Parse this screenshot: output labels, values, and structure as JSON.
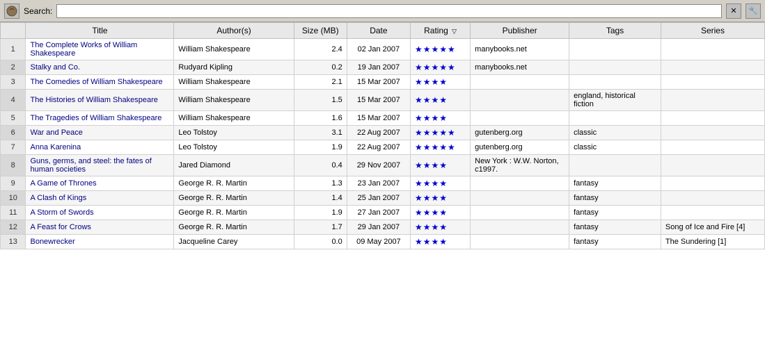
{
  "toolbar": {
    "search_label": "Search:",
    "search_value": "",
    "search_placeholder": ""
  },
  "table": {
    "columns": [
      "Title",
      "Author(s)",
      "Size (MB)",
      "Date",
      "Rating",
      "Publisher",
      "Tags",
      "Series"
    ],
    "rows": [
      {
        "num": 1,
        "title": "The Complete Works of William Shakespeare",
        "authors": "William Shakespeare",
        "size": "2.4",
        "date": "02 Jan 2007",
        "rating": 5,
        "publisher": "manybooks.net",
        "tags": "",
        "series": ""
      },
      {
        "num": 2,
        "title": "Stalky and Co.",
        "authors": "Rudyard Kipling",
        "size": "0.2",
        "date": "19 Jan 2007",
        "rating": 5,
        "publisher": "manybooks.net",
        "tags": "",
        "series": ""
      },
      {
        "num": 3,
        "title": "The Comedies of William Shakespeare",
        "authors": "William Shakespeare",
        "size": "2.1",
        "date": "15 Mar 2007",
        "rating": 4,
        "publisher": "",
        "tags": "",
        "series": ""
      },
      {
        "num": 4,
        "title": "The Histories of William Shakespeare",
        "authors": "William Shakespeare",
        "size": "1.5",
        "date": "15 Mar 2007",
        "rating": 4,
        "publisher": "",
        "tags": "england, historical fiction",
        "series": ""
      },
      {
        "num": 5,
        "title": "The Tragedies of William Shakespeare",
        "authors": "William Shakespeare",
        "size": "1.6",
        "date": "15 Mar 2007",
        "rating": 4,
        "publisher": "",
        "tags": "",
        "series": ""
      },
      {
        "num": 6,
        "title": "War and Peace",
        "authors": "Leo Tolstoy",
        "size": "3.1",
        "date": "22 Aug 2007",
        "rating": 5,
        "publisher": "gutenberg.org",
        "tags": "classic",
        "series": ""
      },
      {
        "num": 7,
        "title": "Anna Karenina",
        "authors": "Leo Tolstoy",
        "size": "1.9",
        "date": "22 Aug 2007",
        "rating": 5,
        "publisher": "gutenberg.org",
        "tags": "classic",
        "series": ""
      },
      {
        "num": 8,
        "title": "Guns, germs, and steel: the fates of human societies",
        "authors": "Jared Diamond",
        "size": "0.4",
        "date": "29 Nov 2007",
        "rating": 4,
        "publisher": "New York : W.W. Norton, c1997.",
        "tags": "",
        "series": ""
      },
      {
        "num": 9,
        "title": "A Game of Thrones",
        "authors": "George R. R. Martin",
        "size": "1.3",
        "date": "23 Jan 2007",
        "rating": 4,
        "publisher": "",
        "tags": "fantasy",
        "series": ""
      },
      {
        "num": 10,
        "title": "A Clash of Kings",
        "authors": "George R. R. Martin",
        "size": "1.4",
        "date": "25 Jan 2007",
        "rating": 4,
        "publisher": "",
        "tags": "fantasy",
        "series": ""
      },
      {
        "num": 11,
        "title": "A Storm of Swords",
        "authors": "George R. R. Martin",
        "size": "1.9",
        "date": "27 Jan 2007",
        "rating": 4,
        "publisher": "",
        "tags": "fantasy",
        "series": ""
      },
      {
        "num": 12,
        "title": "A Feast for Crows",
        "authors": "George R. R. Martin",
        "size": "1.7",
        "date": "29 Jan 2007",
        "rating": 4,
        "publisher": "",
        "tags": "fantasy",
        "series": "Song of Ice and Fire [4]"
      },
      {
        "num": 13,
        "title": "Bonewrecker",
        "authors": "Jacqueline Carey",
        "size": "0.0",
        "date": "09 May 2007",
        "rating": 4,
        "publisher": "",
        "tags": "fantasy",
        "series": "The Sundering [1]"
      }
    ]
  },
  "icons": {
    "toolbar_left": "🎭",
    "toolbar_right_1": "⚙",
    "toolbar_right_2": "🔧"
  }
}
